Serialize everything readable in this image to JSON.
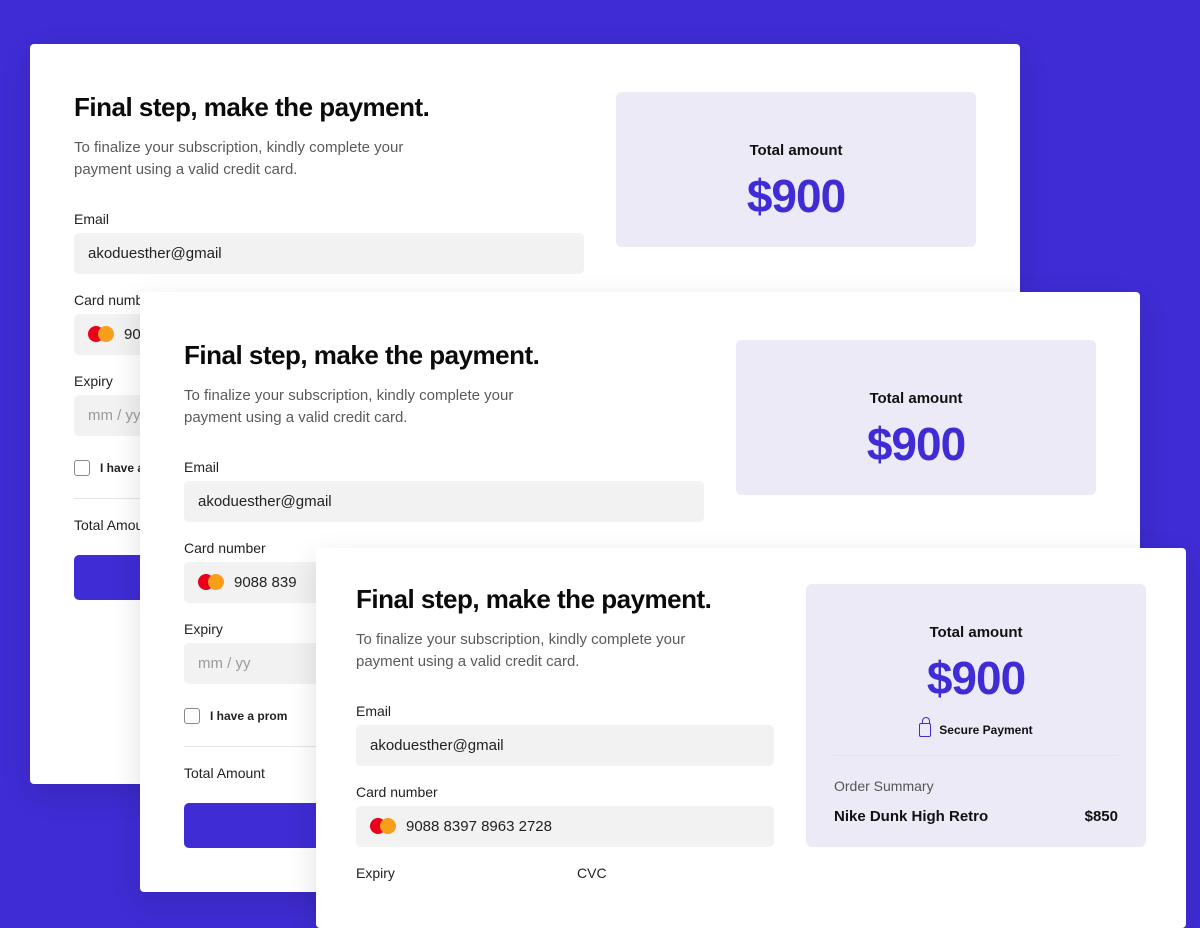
{
  "accent": "#3f2cd4",
  "heading": "Final step, make the payment.",
  "subtext": "To finalize your subscription, kindly complete your payment using a valid credit card.",
  "email_label": "Email",
  "email_value": "akoduesther@gmail",
  "card_label": "Card number",
  "card_value_short": "9088",
  "card_value_mid": "9088 839",
  "card_value_full": "9088 8397 8963 2728",
  "expiry_label": "Expiry",
  "expiry_placeholder": "mm / yy",
  "cvc_label": "CVC",
  "promo_label_short": "I have a p",
  "promo_label_mid": "I have a prom",
  "total_label_short": "Total Amou",
  "total_label": "Total Amount",
  "amount_card": {
    "label": "Total amount",
    "value": "$900",
    "secure": "Secure Payment"
  },
  "order_summary_label": "Order Summary",
  "order_summary": {
    "name": "Nike Dunk High Retro",
    "price": "$850"
  }
}
